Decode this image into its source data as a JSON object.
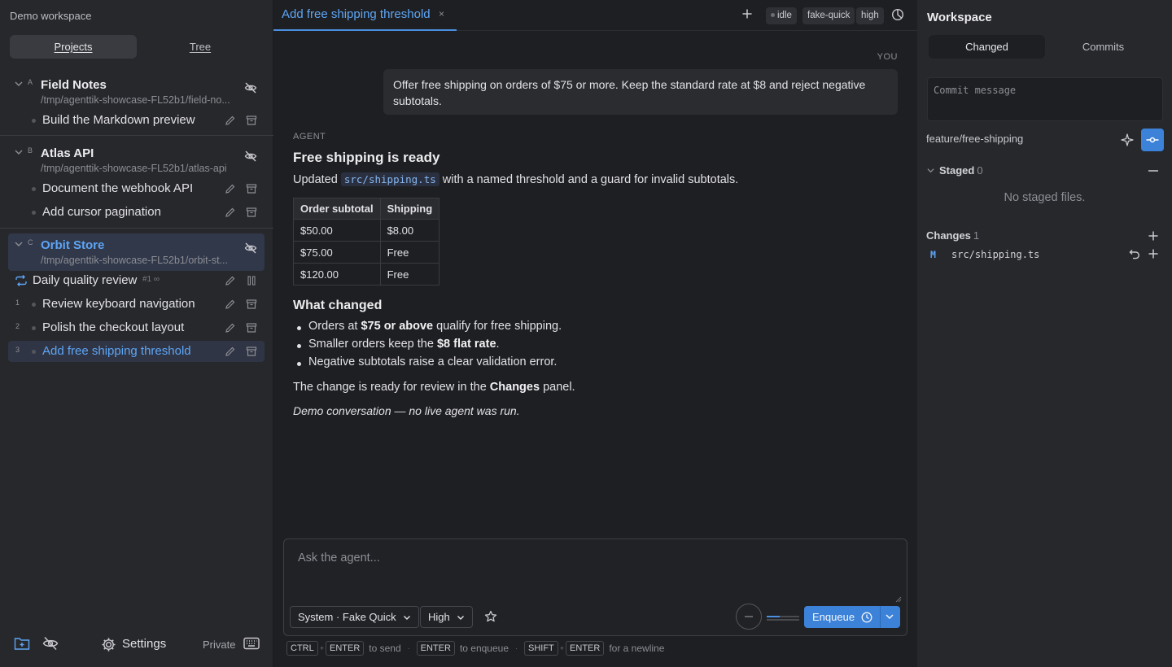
{
  "sidebar": {
    "workspace_title": "Demo workspace",
    "tabs": [
      {
        "label": "Projects",
        "active": true
      },
      {
        "label": "Tree",
        "active": false
      }
    ],
    "projects": [
      {
        "letter": "A",
        "name": "Field Notes",
        "path": "/tmp/agenttik-showcase-FL52b1/field-no...",
        "tasks": [
          {
            "num": "",
            "name": "Build the Markdown preview"
          }
        ]
      },
      {
        "letter": "B",
        "name": "Atlas API",
        "path": "/tmp/agenttik-showcase-FL52b1/atlas-api",
        "tasks": [
          {
            "num": "",
            "name": "Document the webhook API"
          },
          {
            "num": "",
            "name": "Add cursor pagination"
          }
        ]
      },
      {
        "letter": "C",
        "name": "Orbit Store",
        "path": "/tmp/agenttik-showcase-FL52b1/orbit-st...",
        "recurring": {
          "name": "Daily quality review",
          "badge": "#1 ∞"
        },
        "tasks": [
          {
            "num": "1",
            "name": "Review keyboard navigation"
          },
          {
            "num": "2",
            "name": "Polish the checkout layout"
          },
          {
            "num": "3",
            "name": "Add free shipping threshold"
          }
        ]
      }
    ],
    "footer": {
      "settings_label": "Settings",
      "private_label": "Private"
    }
  },
  "tabbar": {
    "active_tab": "Add free shipping threshold",
    "close_glyph": "×",
    "pills": [
      "idle",
      "fake-quick",
      "high"
    ]
  },
  "conversation": {
    "you_label": "YOU",
    "user_message": "Offer free shipping on orders of $75 or more. Keep the standard rate at $8 and reject negative subtotals.",
    "agent_label": "AGENT",
    "heading": "Free shipping is ready",
    "intro_before": "Updated ",
    "intro_code": "src/shipping.ts",
    "intro_after": " with a named threshold and a guard for invalid subtotals.",
    "table": {
      "headers": [
        "Order subtotal",
        "Shipping"
      ],
      "rows": [
        [
          "$50.00",
          "$8.00"
        ],
        [
          "$75.00",
          "Free"
        ],
        [
          "$120.00",
          "Free"
        ]
      ]
    },
    "what_changed_heading": "What changed",
    "bullets": [
      {
        "pre": "Orders at ",
        "bold": "$75 or above",
        "post": " qualify for free shipping."
      },
      {
        "pre": "Smaller orders keep the ",
        "bold": "$8 flat rate",
        "post": "."
      },
      {
        "pre": "Negative subtotals raise a clear validation error.",
        "bold": "",
        "post": ""
      }
    ],
    "review_pre": "The change is ready for review in the ",
    "review_bold": "Changes",
    "review_post": " panel.",
    "demo_note": "Demo conversation — no live agent was run."
  },
  "composer": {
    "placeholder": "Ask the agent...",
    "model_select": "System · Fake Quick",
    "effort_select": "High",
    "progress_fraction": 0.4,
    "enqueue_label": "Enqueue"
  },
  "hints": {
    "ctrl": "CTRL",
    "enter": "ENTER",
    "shift": "SHIFT",
    "plus": "+",
    "to_send": "to send",
    "sep": "·",
    "to_enqueue": "to enqueue",
    "for_newline": "for a newline"
  },
  "workspace": {
    "title": "Workspace",
    "tabs": [
      {
        "label": "Changed",
        "active": true
      },
      {
        "label": "Commits",
        "active": false
      }
    ],
    "commit_placeholder": "Commit message",
    "branch": "feature/free-shipping",
    "staged_label": "Staged",
    "staged_count": "0",
    "no_staged": "No staged files.",
    "changes_label": "Changes",
    "changes_count": "1",
    "files": [
      {
        "status": "M",
        "name": "src/shipping.ts"
      }
    ]
  },
  "colors": {
    "accent": "#3b82d8",
    "accent_text": "#5ea5f5",
    "selected_bg": "#31384a"
  }
}
